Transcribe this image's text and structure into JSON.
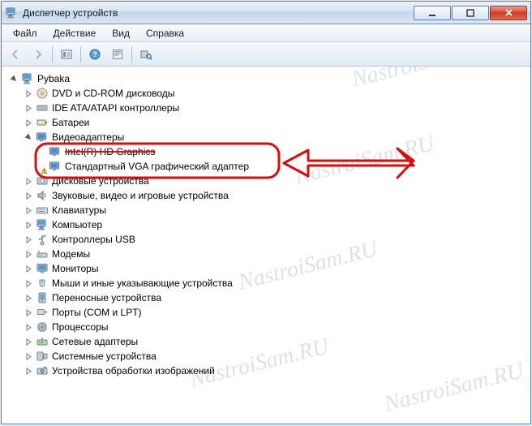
{
  "window": {
    "title": "Диспетчер устройств"
  },
  "menu": {
    "file": "Файл",
    "action": "Действие",
    "view": "Вид",
    "help": "Справка"
  },
  "tree": {
    "root": "Pybaka",
    "items": [
      "DVD и CD-ROM дисководы",
      "IDE ATA/ATAPI контроллеры",
      "Батареи",
      "Видеоадаптеры",
      "Дисковые устройства",
      "Звуковые, видео и игровые устройства",
      "Клавиатуры",
      "Компьютер",
      "Контроллеры USB",
      "Модемы",
      "Мониторы",
      "Мыши и иные указывающие устройства",
      "Переносные устройства",
      "Порты (COM и LPT)",
      "Процессоры",
      "Сетевые адаптеры",
      "Системные устройства",
      "Устройства обработки изображений"
    ],
    "video_children": [
      "Intel(R) HD Graphics",
      "Стандартный VGA графический адаптер"
    ]
  },
  "watermark": "NastroiSam.RU"
}
